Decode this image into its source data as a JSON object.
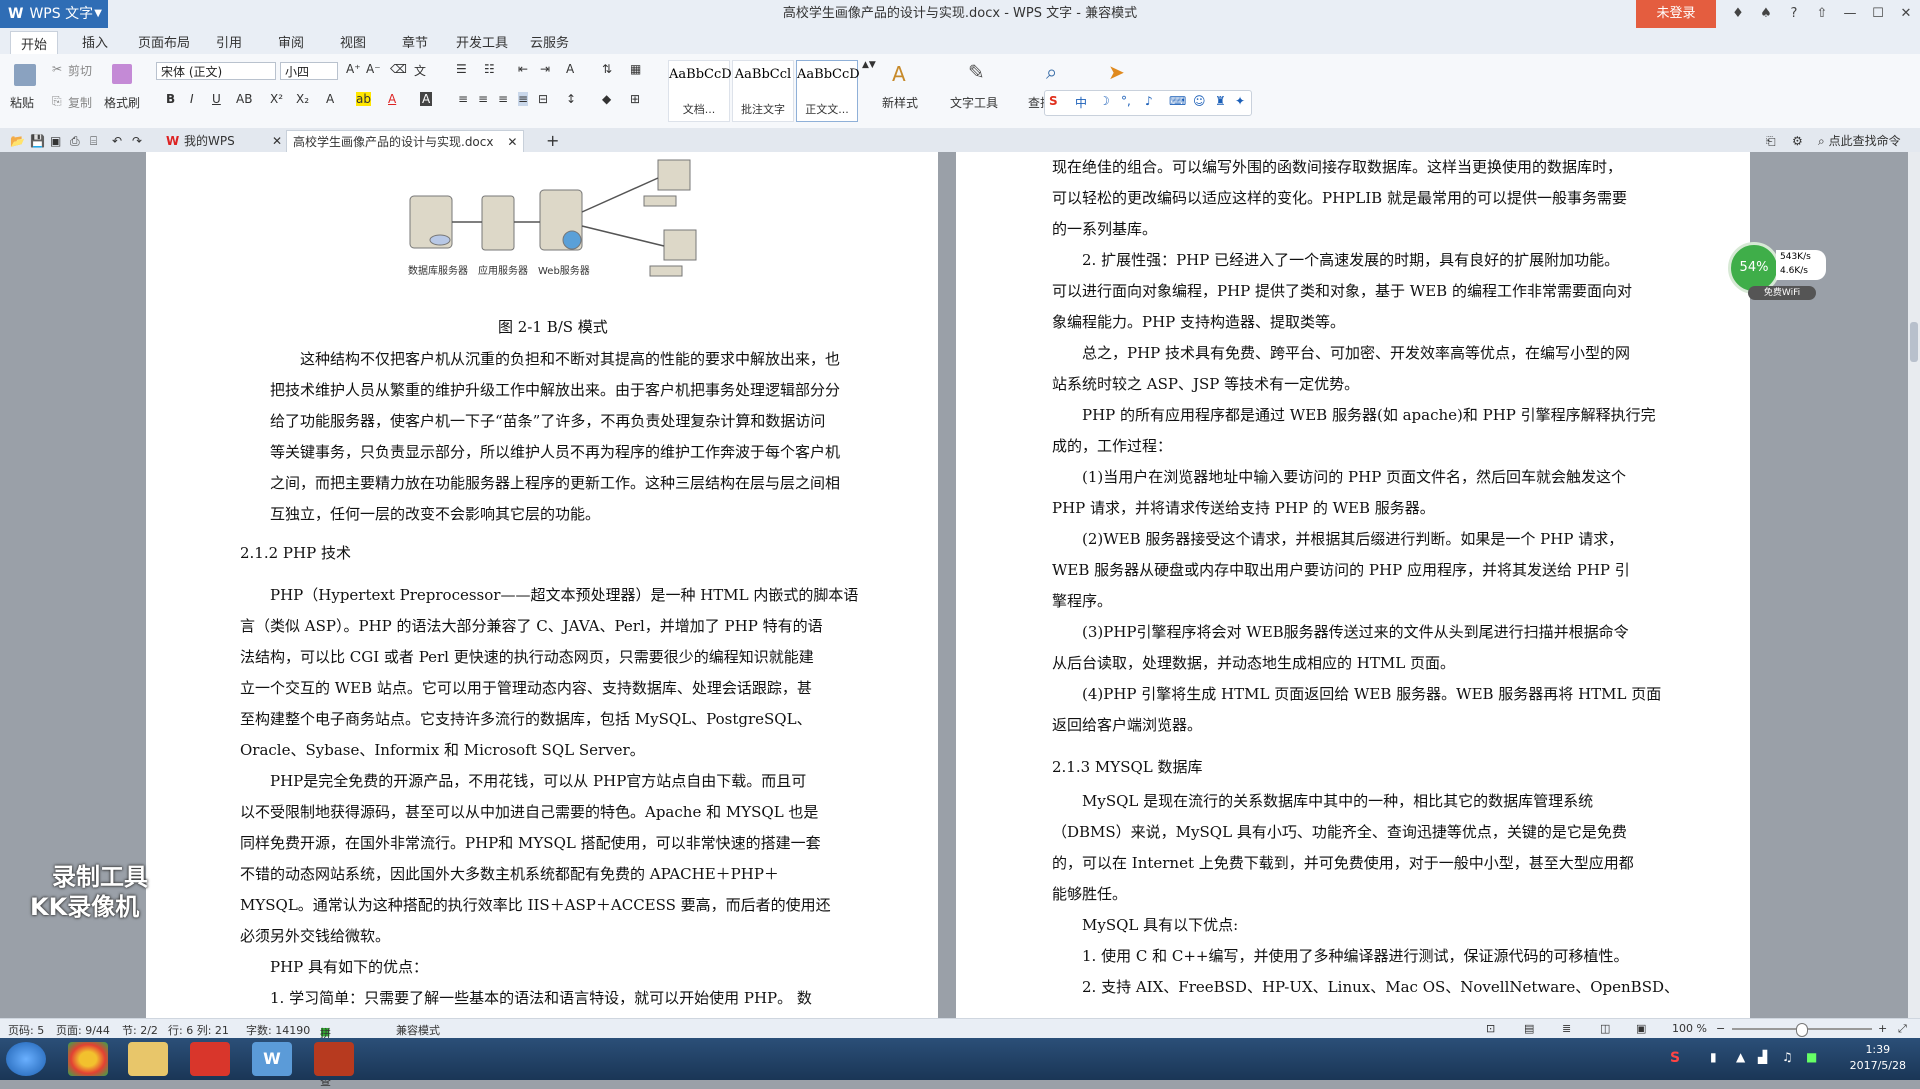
{
  "app": {
    "name": "WPS 文字",
    "window_title": "高校学生画像产品的设计与实现.docx - WPS 文字 - 兼容模式",
    "login_label": "未登录"
  },
  "menu": [
    "开始",
    "插入",
    "页面布局",
    "引用",
    "审阅",
    "视图",
    "章节",
    "开发工具",
    "云服务"
  ],
  "ribbon": {
    "paste": "粘贴",
    "cut": "剪切",
    "copy": "复制",
    "format_painter": "格式刷",
    "font_name": "宋体 (正文)",
    "font_size": "小四",
    "styles": [
      {
        "sample": "AaBbCcDd",
        "label": "文档..."
      },
      {
        "sample": "AaBbCcl",
        "label": "批注文字"
      },
      {
        "sample": "AaBbCcD",
        "label": "正文文..."
      }
    ],
    "new_style": "新样式",
    "text_tools": "文字工具",
    "find": "查找"
  },
  "tabs": {
    "my_wps": "我的WPS",
    "document": "高校学生画像产品的设计与实现.docx",
    "search_cmd": "点此查找命令"
  },
  "left_page": {
    "diagram_labels": [
      "数据库服务器",
      "应用服务器",
      "Web服务器"
    ],
    "caption": "图 2-1    B/S 模式",
    "para1": [
      "这种结构不仅把客户机从沉重的负担和不断对其提高的性能的要求中解放出来，也",
      "把技术维护人员从繁重的维护升级工作中解放出来。由于客户机把事务处理逻辑部分分",
      "给了功能服务器，使客户机一下子“苗条”了许多，不再负责处理复杂计算和数据访问",
      "等关键事务，只负责显示部分，所以维护人员不再为程序的维护工作奔波于每个客户机",
      "之间，而把主要精力放在功能服务器上程序的更新工作。这种三层结构在层与层之间相",
      "互独立，任何一层的改变不会影响其它层的功能。"
    ],
    "heading_212": "2.1.2 PHP 技术",
    "para2": [
      "PHP（Hypertext Preprocessor——超文本预处理器）是一种 HTML 内嵌式的脚本语",
      "言（类似 ASP）。PHP 的语法大部分兼容了 C、JAVA、Perl，并增加了 PHP 特有的语",
      "法结构，可以比 CGI 或者 Perl 更快速的执行动态网页，只需要很少的编程知识就能建",
      "立一个交互的 WEB 站点。它可以用于管理动态内容、支持数据库、处理会话跟踪，甚",
      "至构建整个电子商务站点。它支持许多流行的数据库，包括 MySQL、PostgreSQL、",
      "Oracle、Sybase、Informix  和  Microsoft SQL Server。"
    ],
    "para3": [
      "PHP是完全免费的开源产品，不用花钱，可以从 PHP官方站点自由下载。而且可",
      "以不受限制地获得源码，甚至可以从中加进自己需要的特色。Apache 和 MYSQL 也是",
      "同样免费开源，在国外非常流行。PHP和 MYSQL 搭配使用，可以非常快速的搭建一套",
      "不错的动态网站系统，因此国外大多数主机系统都配有免费的 APACHE＋PHP＋",
      "MYSQL。通常认为这种搭配的执行效率比 IIS＋ASP＋ACCESS 要高，而后者的使用还",
      "必须另外交钱给微软。"
    ],
    "para4": "PHP 具有如下的优点：",
    "para5": "1. 学习简单：只需要了解一些基本的语法和语言特设，就可以开始使用 PHP。 数"
  },
  "right_page": {
    "lines": [
      "现在绝佳的组合。可以编写外围的函数间接存取数据库。这样当更换使用的数据库时，",
      "可以轻松的更改编码以适应这样的变化。PHPLIB 就是最常用的可以提供一般事务需要",
      "的一系列基库。",
      "2.  扩展性强：PHP 已经进入了一个高速发展的时期，具有良好的扩展附加功能。",
      "可以进行面向对象编程，PHP 提供了类和对象，基于 WEB 的编程工作非常需要面向对",
      "象编程能力。PHP 支持构造器、提取类等。",
      "总之，PHP 技术具有免费、跨平台、可加密、开发效率高等优点，在编写小型的网",
      "站系统时较之 ASP、JSP 等技术有一定优势。",
      "PHP 的所有应用程序都是通过 WEB 服务器(如 apache)和 PHP 引擎程序解释执行完",
      "成的，工作过程：",
      "(1)当用户在浏览器地址中输入要访问的 PHP 页面文件名，然后回车就会触发这个",
      "PHP 请求，并将请求传送给支持 PHP 的 WEB 服务器。",
      "(2)WEB 服务器接受这个请求，并根据其后缀进行判断。如果是一个 PHP 请求，",
      "WEB  服务器从硬盘或内存中取出用户要访问的 PHP 应用程序，并将其发送给 PHP 引",
      "擎程序。",
      "(3)PHP引擎程序将会对 WEB服务器传送过来的文件从头到尾进行扫描并根据命令",
      "从后台读取，处理数据，并动态地生成相应的 HTML 页面。",
      "(4)PHP 引擎将生成 HTML 页面返回给 WEB 服务器。WEB 服务器再将 HTML 页面",
      "返回给客户端浏览器。"
    ],
    "heading_213": "2.1.3 MYSQL 数据库",
    "mysql_lines": [
      "MySQL 是现在流行的关系数据库中其中的一种，相比其它的数据库管理系统",
      "（DBMS）来说，MySQL 具有小巧、功能齐全、查询迅捷等优点，关键的是它是免费",
      "的，可以在 Internet 上免费下载到，并可免费使用，对于一般中小型，甚至大型应用都",
      "能够胜任。",
      "MySQL 具有以下优点:",
      "1.  使用 C 和 C++编写，并使用了多种编译器进行测试，保证源代码的可移植性。",
      "2.  支持 AIX、FreeBSD、HP-UX、Linux、Mac OS、NovellNetware、OpenBSD、"
    ]
  },
  "net_meter": {
    "percent": "54%",
    "up": "543K/s",
    "down": "4.6K/s",
    "wifi": "免费WiFi"
  },
  "watermark": [
    "录制工具",
    "KK录像机"
  ],
  "status": {
    "page": "页码: 5",
    "pages": "页面: 9/44",
    "section": "节: 2/2",
    "row_col": "行: 6  列: 21",
    "words": "字数: 14190",
    "spell": "拼写检查",
    "compat": "兼容模式",
    "zoom": "100 %"
  },
  "clock": {
    "time": "1:39",
    "date": "2017/5/28"
  }
}
